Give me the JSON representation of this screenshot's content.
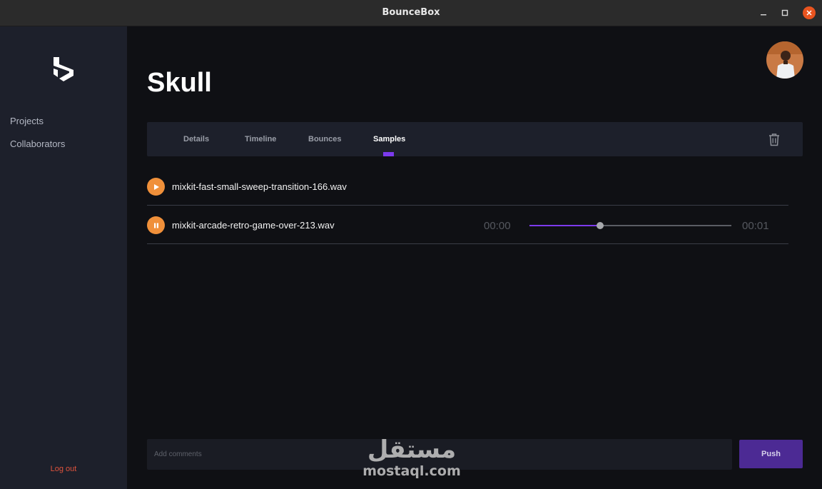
{
  "window": {
    "title": "BounceBox"
  },
  "sidebar": {
    "items": [
      {
        "label": "Projects"
      },
      {
        "label": "Collaborators"
      }
    ],
    "logout_label": "Log out"
  },
  "main": {
    "title": "Skull",
    "tabs": [
      {
        "label": "Details"
      },
      {
        "label": "Timeline"
      },
      {
        "label": "Bounces"
      },
      {
        "label": "Samples",
        "active": true
      }
    ],
    "samples": [
      {
        "filename": "mixkit-fast-small-sweep-transition-166.wav",
        "state": "paused",
        "icon": "play-icon"
      },
      {
        "filename": "mixkit-arcade-retro-game-over-213.wav",
        "state": "playing",
        "icon": "pause-icon",
        "current_time": "00:00",
        "duration": "00:01",
        "progress": 0.35
      }
    ],
    "comment": {
      "placeholder": "Add comments",
      "value": ""
    },
    "push_label": "Push"
  },
  "watermark": {
    "arabic": "مستقل",
    "latin": "mostaql.com"
  },
  "colors": {
    "accent": "#7c3aed",
    "play_button": "#f0903a",
    "push_button": "#4c2a94",
    "logout": "#e0533d",
    "close_button": "#e9541f"
  }
}
